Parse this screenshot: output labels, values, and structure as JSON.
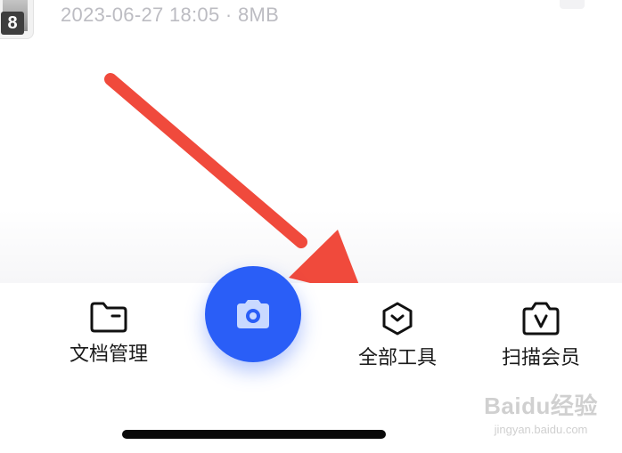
{
  "file_item": {
    "thumbnail_badge": "8",
    "meta": "2023-06-27 18:05 · 8MB"
  },
  "tab_bar": {
    "items": [
      {
        "label": "文档管理",
        "icon": "folder-icon"
      },
      {
        "label": "全部工具",
        "icon": "tools-hexagon-icon"
      },
      {
        "label": "扫描会员",
        "icon": "vip-camera-icon"
      }
    ],
    "fab_icon": "camera-icon"
  },
  "watermark": {
    "brand": "Baidu经验",
    "url": "jingyan.baidu.com"
  },
  "colors": {
    "accent": "#2a5ef7",
    "annotation_arrow": "#f04a3c",
    "meta_text": "#bcbcc2"
  }
}
